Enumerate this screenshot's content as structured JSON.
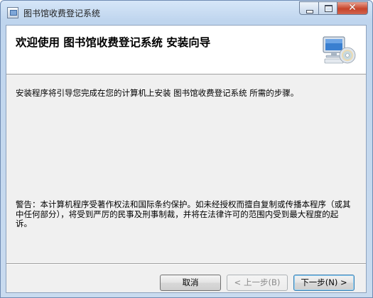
{
  "window": {
    "title": "图书馆收费登记系统",
    "close_glyph": "✕"
  },
  "banner": {
    "title": "欢迎使用  图书馆收费登记系统  安装向导",
    "art_icon": "computer-cd-icon"
  },
  "body": {
    "description": "安装程序将引导您完成在您的计算机上安装  图书馆收费登记系统  所需的步骤。",
    "warning": "警告：本计算机程序受著作权法和国际条约保护。如未经授权而擅自复制或传播本程序（或其中任何部分），将受到严厉的民事及刑事制裁，并将在法律许可的范围内受到最大程度的起诉。"
  },
  "buttons": {
    "cancel": "取消",
    "back": "< 上一步(B)",
    "next": "下一步(N) >"
  },
  "colors": {
    "titlebar": "#c9dbef",
    "close_button": "#c7442a",
    "client_background": "#f0f0f0"
  }
}
